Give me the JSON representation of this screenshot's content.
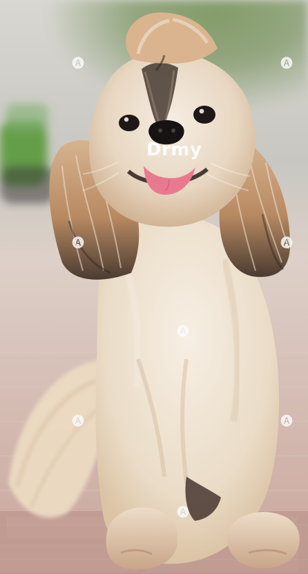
{
  "image": {
    "subject": "shih-tzu-dog",
    "scene": "sidewalk",
    "watermark_text": "🅐",
    "watermark_center_text": "Drmy",
    "colors": {
      "sky": "#d8d7d1",
      "trees": "#6f8f57",
      "pavement_light": "#d9cac1",
      "pavement_dark": "#b58f86",
      "fur_cream": "#efe4d2",
      "fur_tan": "#c6a27b",
      "fur_dark": "#4a3b31",
      "tongue": "#e9798f",
      "car_green": "#5a9a3c"
    }
  }
}
